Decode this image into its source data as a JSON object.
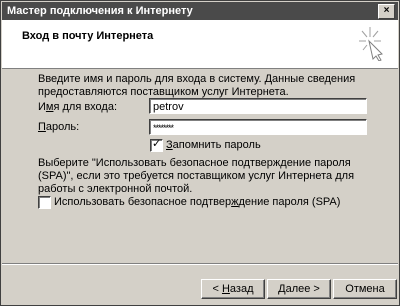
{
  "window": {
    "title": "Мастер подключения к Интернету",
    "close_glyph": "×"
  },
  "header": {
    "title": "Вход в почту Интернета",
    "icon": "wizard-sparkle-icon"
  },
  "form": {
    "intro": "Введите имя и пароль для входа в систему. Данные сведения предоставляются поставщиком услуг Интернета.",
    "username_label_pre": "И",
    "username_label_ul": "м",
    "username_label_post": "я для входа:",
    "username_value": "petrov",
    "password_label_ul": "П",
    "password_label_post": "ароль:",
    "password_value": "********",
    "remember_checked_glyph": "✓",
    "remember_label_ul": "З",
    "remember_label_post": "апомнить пароль",
    "spa_description": "Выберите \"Использовать безопасное подтверждение пароля (SPA)\", если это требуется поставщиком услуг Интернета для работы с электронной почтой.",
    "spa_label_pre": "Использовать безопасное подтвер",
    "spa_label_ul": "ж",
    "spa_label_post": "дение пароля (SPA)"
  },
  "buttons": {
    "back_pre": "< ",
    "back_ul": "Н",
    "back_post": "азад",
    "next_label": "Далее >",
    "cancel_label": "Отмена"
  }
}
